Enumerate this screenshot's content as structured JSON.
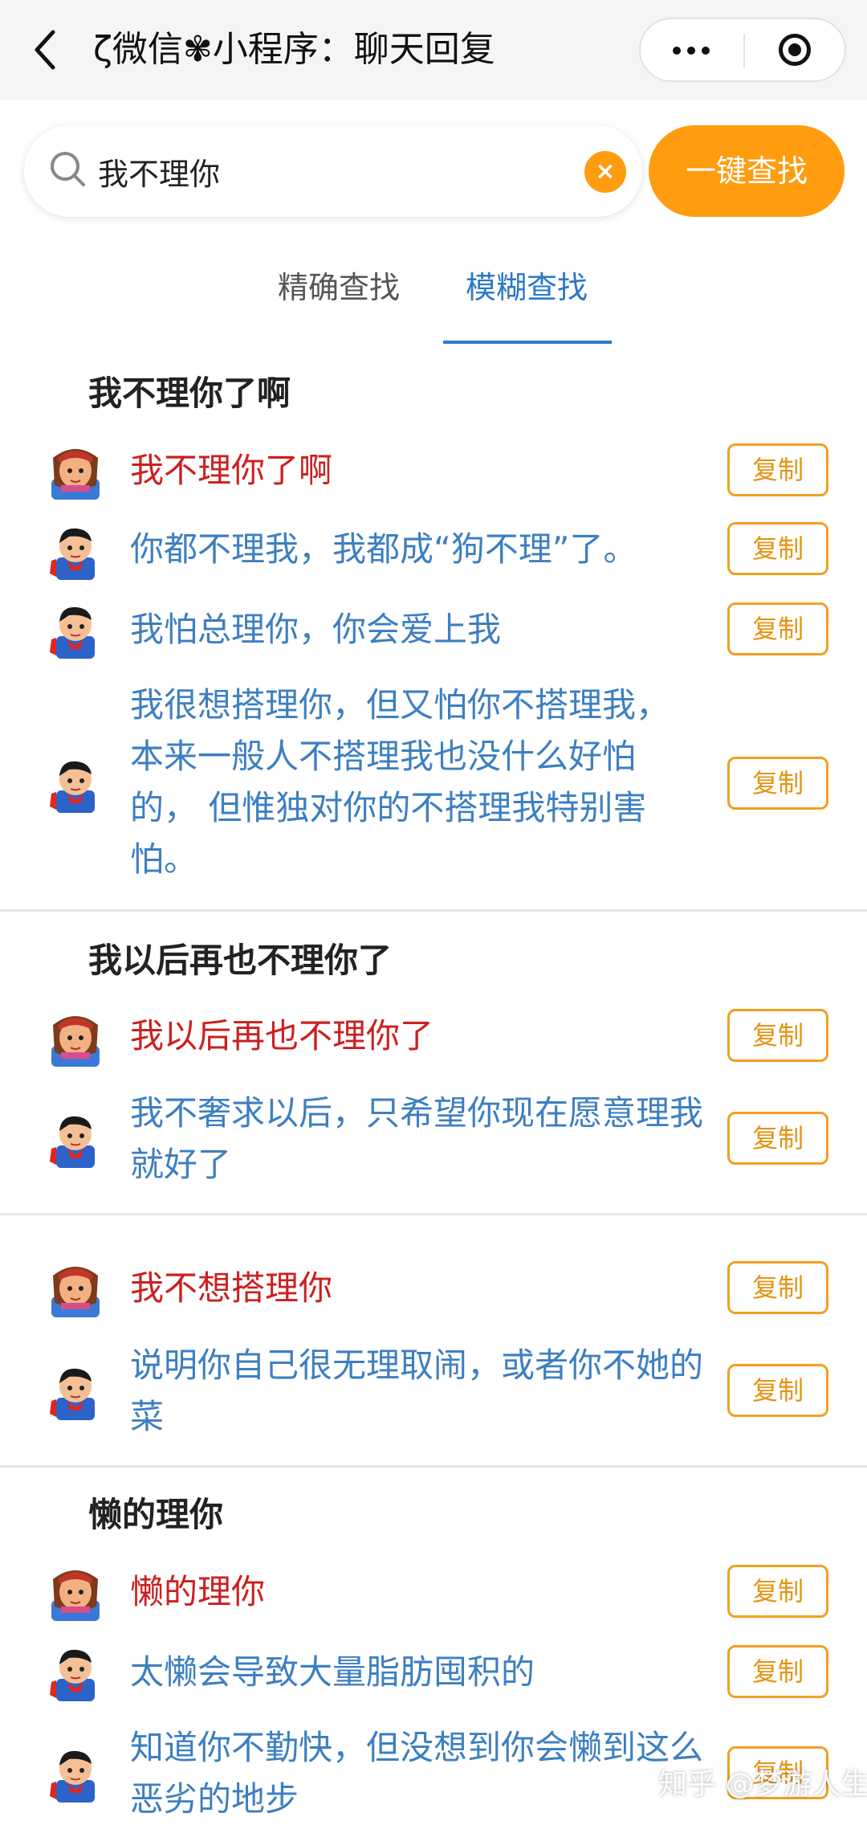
{
  "nav": {
    "title": "ζ微信✾小程序：聊天回复"
  },
  "search": {
    "value": "我不理你",
    "clear_label": "×",
    "find_label": "一键查找"
  },
  "tabs": {
    "exact": "精确查找",
    "fuzzy": "模糊查找",
    "active": "fuzzy"
  },
  "copy_label": "复制",
  "groups": [
    {
      "title": "我不理你了啊",
      "messages": [
        {
          "role": "q",
          "text": "我不理你了啊"
        },
        {
          "role": "a",
          "text": "你都不理我，我都成“狗不理”了。"
        },
        {
          "role": "a",
          "text": "我怕总理你，你会爱上我"
        },
        {
          "role": "a",
          "text": "我很想搭理你，但又怕你不搭理我，本来一般人不搭理我也没什么好怕的， 但惟独对你的不搭理我特别害怕。"
        }
      ]
    },
    {
      "title": "我以后再也不理你了",
      "messages": [
        {
          "role": "q",
          "text": "我以后再也不理你了"
        },
        {
          "role": "a",
          "text": "我不奢求以后，只希望你现在愿意理我就好了"
        }
      ]
    },
    {
      "title": "",
      "messages": [
        {
          "role": "q",
          "text": "我不想搭理你"
        },
        {
          "role": "a",
          "text": "说明你自己很无理取闹，或者你不她的菜"
        }
      ]
    },
    {
      "title": "懒的理你",
      "messages": [
        {
          "role": "q",
          "text": "懒的理你"
        },
        {
          "role": "a",
          "text": "太懒会导致大量脂肪囤积的"
        },
        {
          "role": "a",
          "text": "知道你不勤快，但没想到你会懒到这么恶劣的地步"
        }
      ]
    }
  ],
  "watermark": "知乎 @梦游人生",
  "colors": {
    "accent": "#ff9c10",
    "question": "#cc1f1f",
    "answer": "#3d7fc1",
    "tab_active": "#2a78c8"
  },
  "icons": {
    "back": "chevron-left-icon",
    "more": "more-dots-icon",
    "close": "target-circle-icon",
    "search": "search-icon",
    "avatar_q": "girl-avatar-icon",
    "avatar_a": "superman-avatar-icon"
  }
}
